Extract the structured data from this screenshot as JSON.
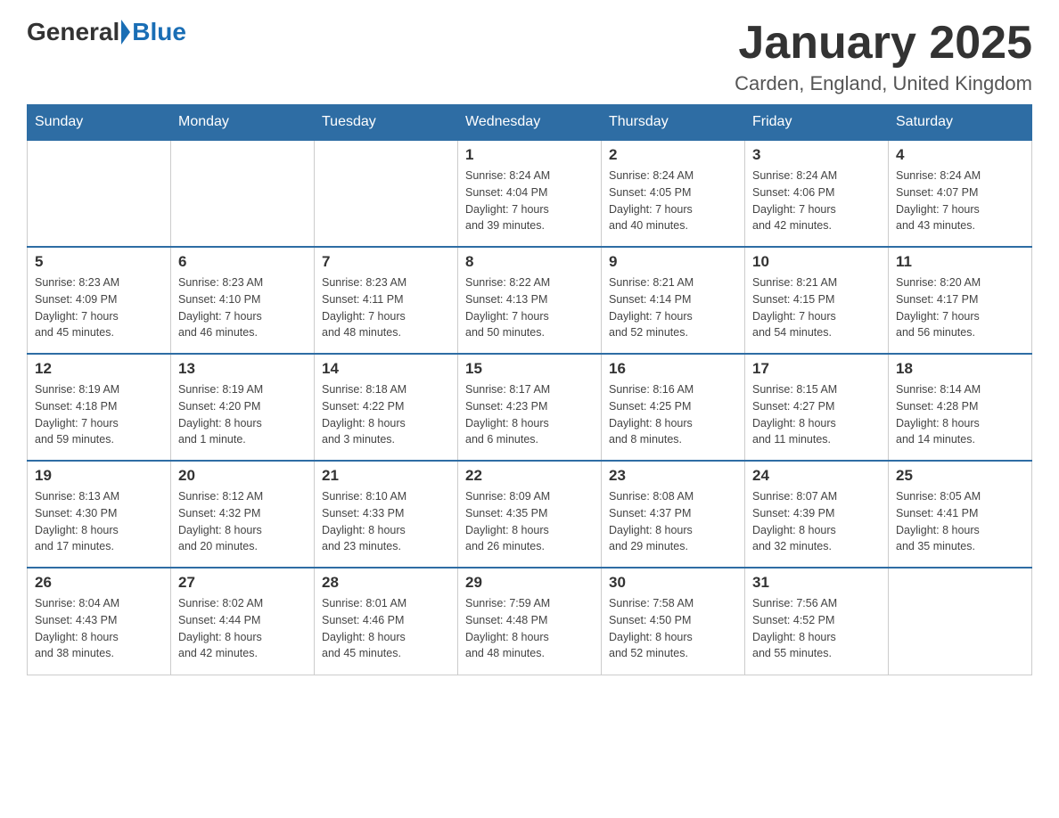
{
  "logo": {
    "general": "General",
    "blue": "Blue"
  },
  "title": "January 2025",
  "location": "Carden, England, United Kingdom",
  "weekdays": [
    "Sunday",
    "Monday",
    "Tuesday",
    "Wednesday",
    "Thursday",
    "Friday",
    "Saturday"
  ],
  "weeks": [
    [
      {
        "day": "",
        "sunrise": "",
        "sunset": "",
        "daylight": ""
      },
      {
        "day": "",
        "sunrise": "",
        "sunset": "",
        "daylight": ""
      },
      {
        "day": "",
        "sunrise": "",
        "sunset": "",
        "daylight": ""
      },
      {
        "day": "1",
        "sunrise": "Sunrise: 8:24 AM",
        "sunset": "Sunset: 4:04 PM",
        "daylight": "Daylight: 7 hours and 39 minutes."
      },
      {
        "day": "2",
        "sunrise": "Sunrise: 8:24 AM",
        "sunset": "Sunset: 4:05 PM",
        "daylight": "Daylight: 7 hours and 40 minutes."
      },
      {
        "day": "3",
        "sunrise": "Sunrise: 8:24 AM",
        "sunset": "Sunset: 4:06 PM",
        "daylight": "Daylight: 7 hours and 42 minutes."
      },
      {
        "day": "4",
        "sunrise": "Sunrise: 8:24 AM",
        "sunset": "Sunset: 4:07 PM",
        "daylight": "Daylight: 7 hours and 43 minutes."
      }
    ],
    [
      {
        "day": "5",
        "sunrise": "Sunrise: 8:23 AM",
        "sunset": "Sunset: 4:09 PM",
        "daylight": "Daylight: 7 hours and 45 minutes."
      },
      {
        "day": "6",
        "sunrise": "Sunrise: 8:23 AM",
        "sunset": "Sunset: 4:10 PM",
        "daylight": "Daylight: 7 hours and 46 minutes."
      },
      {
        "day": "7",
        "sunrise": "Sunrise: 8:23 AM",
        "sunset": "Sunset: 4:11 PM",
        "daylight": "Daylight: 7 hours and 48 minutes."
      },
      {
        "day": "8",
        "sunrise": "Sunrise: 8:22 AM",
        "sunset": "Sunset: 4:13 PM",
        "daylight": "Daylight: 7 hours and 50 minutes."
      },
      {
        "day": "9",
        "sunrise": "Sunrise: 8:21 AM",
        "sunset": "Sunset: 4:14 PM",
        "daylight": "Daylight: 7 hours and 52 minutes."
      },
      {
        "day": "10",
        "sunrise": "Sunrise: 8:21 AM",
        "sunset": "Sunset: 4:15 PM",
        "daylight": "Daylight: 7 hours and 54 minutes."
      },
      {
        "day": "11",
        "sunrise": "Sunrise: 8:20 AM",
        "sunset": "Sunset: 4:17 PM",
        "daylight": "Daylight: 7 hours and 56 minutes."
      }
    ],
    [
      {
        "day": "12",
        "sunrise": "Sunrise: 8:19 AM",
        "sunset": "Sunset: 4:18 PM",
        "daylight": "Daylight: 7 hours and 59 minutes."
      },
      {
        "day": "13",
        "sunrise": "Sunrise: 8:19 AM",
        "sunset": "Sunset: 4:20 PM",
        "daylight": "Daylight: 8 hours and 1 minute."
      },
      {
        "day": "14",
        "sunrise": "Sunrise: 8:18 AM",
        "sunset": "Sunset: 4:22 PM",
        "daylight": "Daylight: 8 hours and 3 minutes."
      },
      {
        "day": "15",
        "sunrise": "Sunrise: 8:17 AM",
        "sunset": "Sunset: 4:23 PM",
        "daylight": "Daylight: 8 hours and 6 minutes."
      },
      {
        "day": "16",
        "sunrise": "Sunrise: 8:16 AM",
        "sunset": "Sunset: 4:25 PM",
        "daylight": "Daylight: 8 hours and 8 minutes."
      },
      {
        "day": "17",
        "sunrise": "Sunrise: 8:15 AM",
        "sunset": "Sunset: 4:27 PM",
        "daylight": "Daylight: 8 hours and 11 minutes."
      },
      {
        "day": "18",
        "sunrise": "Sunrise: 8:14 AM",
        "sunset": "Sunset: 4:28 PM",
        "daylight": "Daylight: 8 hours and 14 minutes."
      }
    ],
    [
      {
        "day": "19",
        "sunrise": "Sunrise: 8:13 AM",
        "sunset": "Sunset: 4:30 PM",
        "daylight": "Daylight: 8 hours and 17 minutes."
      },
      {
        "day": "20",
        "sunrise": "Sunrise: 8:12 AM",
        "sunset": "Sunset: 4:32 PM",
        "daylight": "Daylight: 8 hours and 20 minutes."
      },
      {
        "day": "21",
        "sunrise": "Sunrise: 8:10 AM",
        "sunset": "Sunset: 4:33 PM",
        "daylight": "Daylight: 8 hours and 23 minutes."
      },
      {
        "day": "22",
        "sunrise": "Sunrise: 8:09 AM",
        "sunset": "Sunset: 4:35 PM",
        "daylight": "Daylight: 8 hours and 26 minutes."
      },
      {
        "day": "23",
        "sunrise": "Sunrise: 8:08 AM",
        "sunset": "Sunset: 4:37 PM",
        "daylight": "Daylight: 8 hours and 29 minutes."
      },
      {
        "day": "24",
        "sunrise": "Sunrise: 8:07 AM",
        "sunset": "Sunset: 4:39 PM",
        "daylight": "Daylight: 8 hours and 32 minutes."
      },
      {
        "day": "25",
        "sunrise": "Sunrise: 8:05 AM",
        "sunset": "Sunset: 4:41 PM",
        "daylight": "Daylight: 8 hours and 35 minutes."
      }
    ],
    [
      {
        "day": "26",
        "sunrise": "Sunrise: 8:04 AM",
        "sunset": "Sunset: 4:43 PM",
        "daylight": "Daylight: 8 hours and 38 minutes."
      },
      {
        "day": "27",
        "sunrise": "Sunrise: 8:02 AM",
        "sunset": "Sunset: 4:44 PM",
        "daylight": "Daylight: 8 hours and 42 minutes."
      },
      {
        "day": "28",
        "sunrise": "Sunrise: 8:01 AM",
        "sunset": "Sunset: 4:46 PM",
        "daylight": "Daylight: 8 hours and 45 minutes."
      },
      {
        "day": "29",
        "sunrise": "Sunrise: 7:59 AM",
        "sunset": "Sunset: 4:48 PM",
        "daylight": "Daylight: 8 hours and 48 minutes."
      },
      {
        "day": "30",
        "sunrise": "Sunrise: 7:58 AM",
        "sunset": "Sunset: 4:50 PM",
        "daylight": "Daylight: 8 hours and 52 minutes."
      },
      {
        "day": "31",
        "sunrise": "Sunrise: 7:56 AM",
        "sunset": "Sunset: 4:52 PM",
        "daylight": "Daylight: 8 hours and 55 minutes."
      },
      {
        "day": "",
        "sunrise": "",
        "sunset": "",
        "daylight": ""
      }
    ]
  ]
}
